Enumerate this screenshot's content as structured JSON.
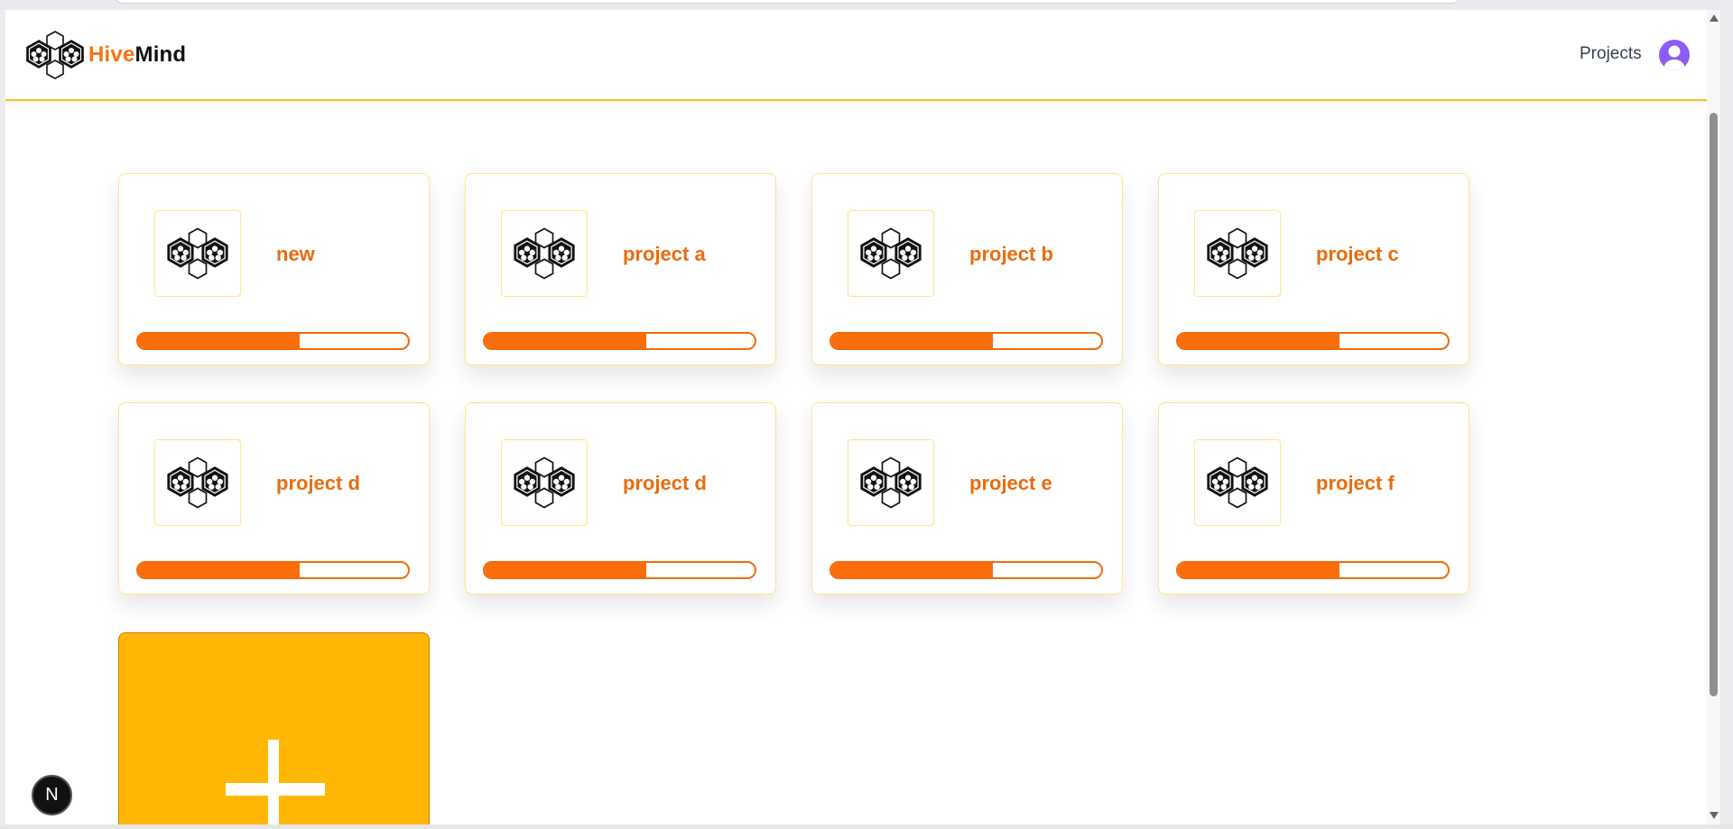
{
  "brand": {
    "hive": "Hive",
    "mind": "Mind",
    "logo_icon": "hive-logo-icon"
  },
  "nav": {
    "projects_label": "Projects",
    "avatar_icon": "user-avatar-icon"
  },
  "projects": [
    {
      "name": "new",
      "progress": 0.6
    },
    {
      "name": "project a",
      "progress": 0.6
    },
    {
      "name": "project b",
      "progress": 0.6
    },
    {
      "name": "project c",
      "progress": 0.6
    },
    {
      "name": "project d",
      "progress": 0.6
    },
    {
      "name": "project d",
      "progress": 0.6
    },
    {
      "name": "project e",
      "progress": 0.6
    },
    {
      "name": "project f",
      "progress": 0.6
    }
  ],
  "add_project": {
    "icon": "plus-icon"
  },
  "dev_badge": {
    "label": "N"
  },
  "colors": {
    "accent_orange": "#f97316",
    "card_border": "#fde68a",
    "add_card_bg": "#ffb703",
    "avatar": "#8b5cf6"
  }
}
